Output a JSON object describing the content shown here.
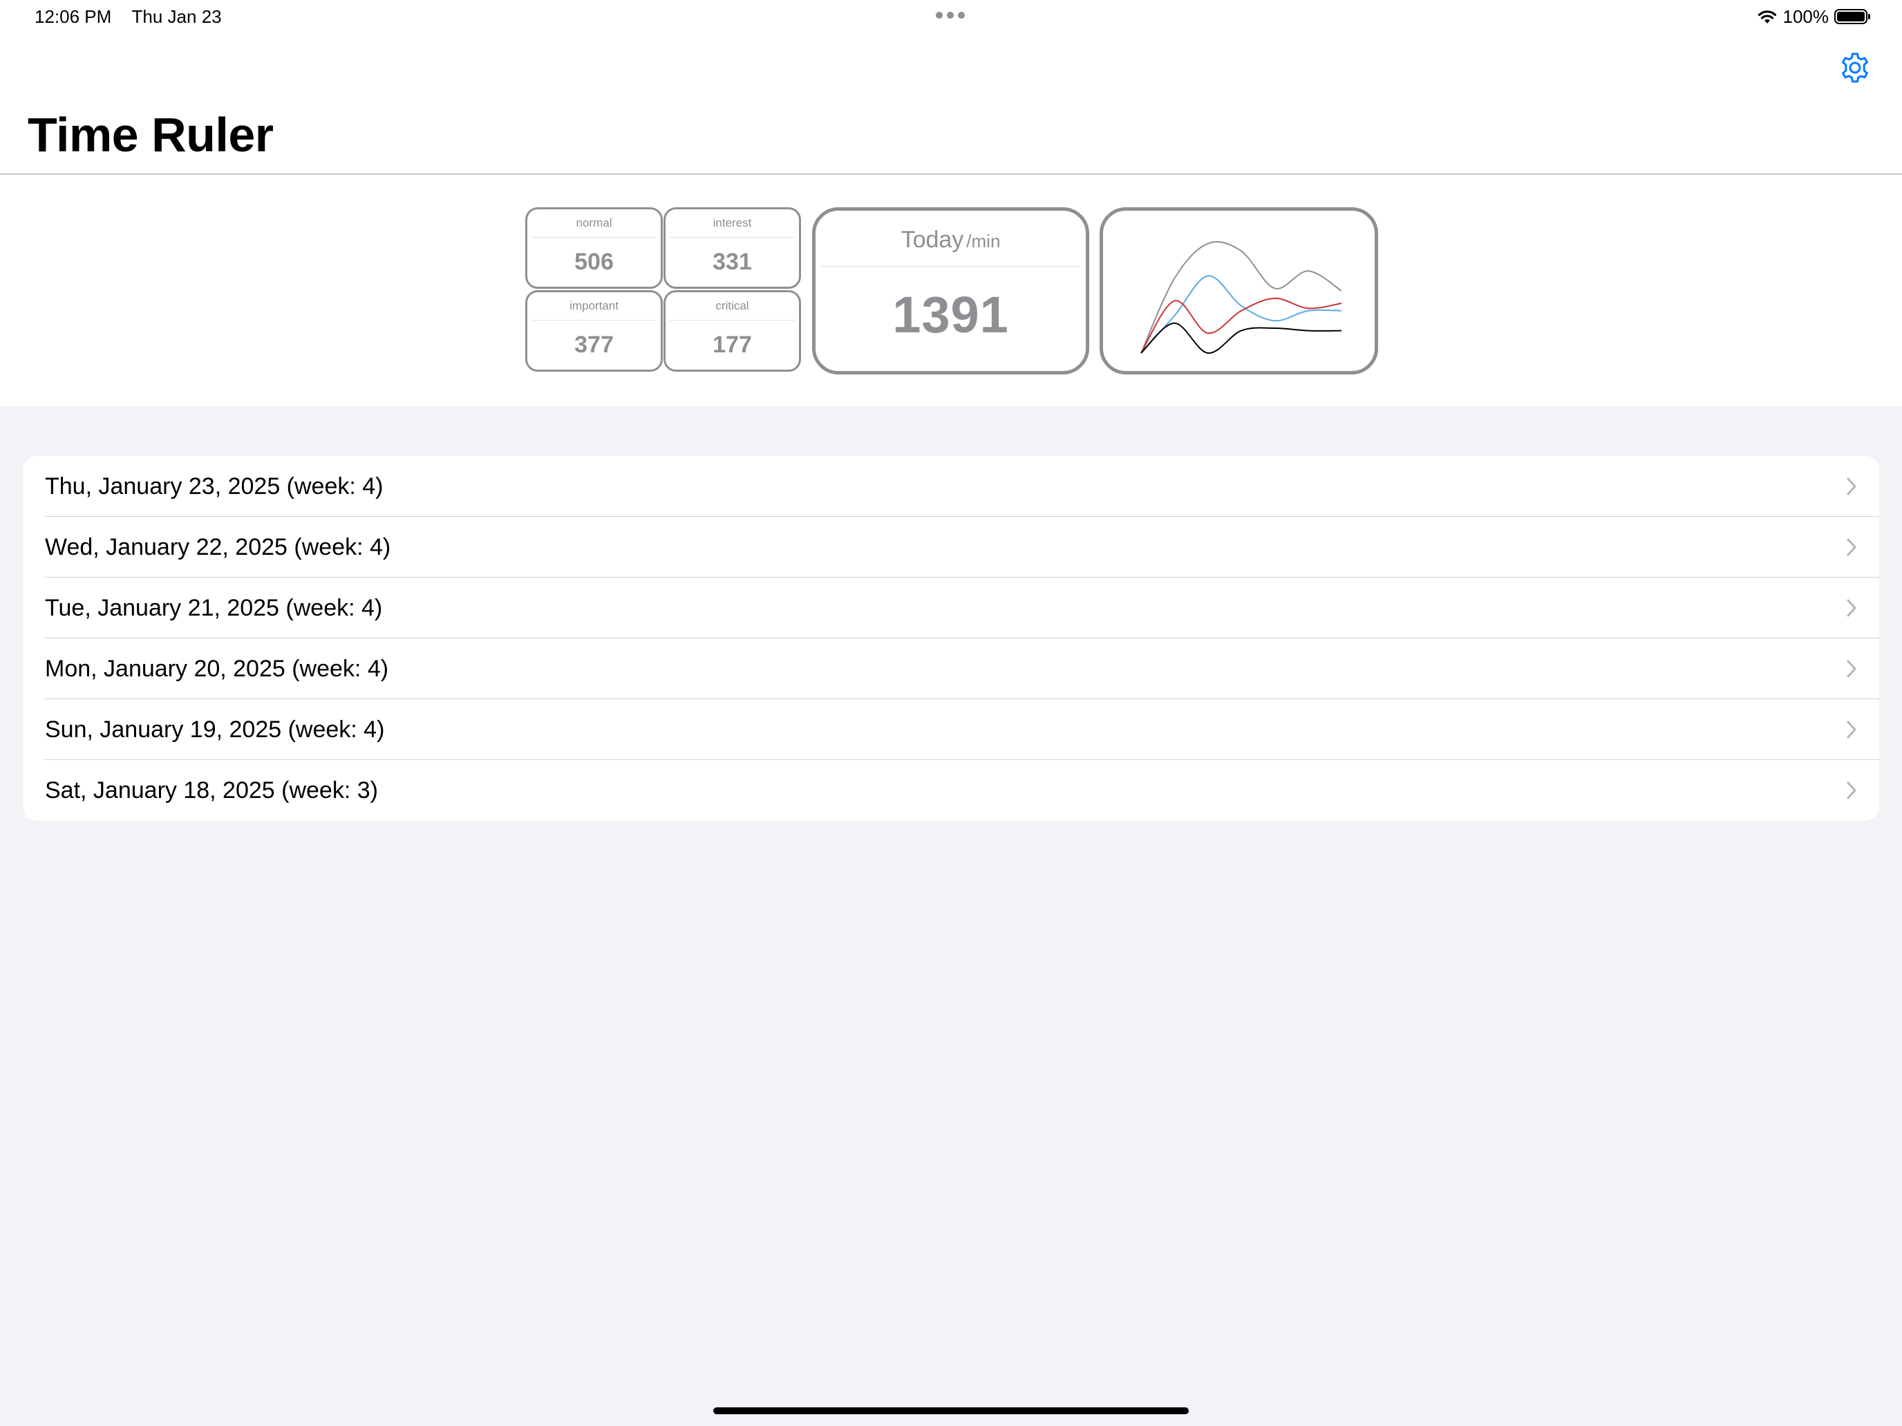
{
  "status_bar": {
    "time": "12:06 PM",
    "date": "Thu Jan 23",
    "battery": "100%"
  },
  "nav": {
    "title": "Time Ruler",
    "settings_icon": "gear-icon",
    "accent_color": "#007aff"
  },
  "stats": {
    "normal": {
      "label": "normal",
      "value": "506"
    },
    "interest": {
      "label": "interest",
      "value": "331"
    },
    "important": {
      "label": "important",
      "value": "377"
    },
    "critical": {
      "label": "critical",
      "value": "177"
    },
    "today": {
      "label": "Today",
      "unit": "/min",
      "value": "1391"
    }
  },
  "chart_data": {
    "type": "line",
    "series": [
      {
        "color": "#8e8e93",
        "values": [
          0,
          60,
          88,
          82,
          52,
          66,
          50
        ]
      },
      {
        "color": "#5aa9e6",
        "values": [
          0,
          30,
          62,
          38,
          26,
          34,
          34
        ]
      },
      {
        "color": "#cc3333",
        "values": [
          0,
          42,
          16,
          34,
          44,
          36,
          40
        ]
      },
      {
        "color": "#000000",
        "values": [
          0,
          24,
          0,
          18,
          20,
          18,
          18
        ]
      }
    ],
    "grid": false,
    "axes": false
  },
  "days": [
    {
      "label": "Thu, January 23, 2025 (week: 4)"
    },
    {
      "label": "Wed, January 22, 2025 (week: 4)"
    },
    {
      "label": "Tue, January 21, 2025 (week: 4)"
    },
    {
      "label": "Mon, January 20, 2025 (week: 4)"
    },
    {
      "label": "Sun, January 19, 2025 (week: 4)"
    },
    {
      "label": "Sat, January 18, 2025 (week: 3)"
    }
  ]
}
